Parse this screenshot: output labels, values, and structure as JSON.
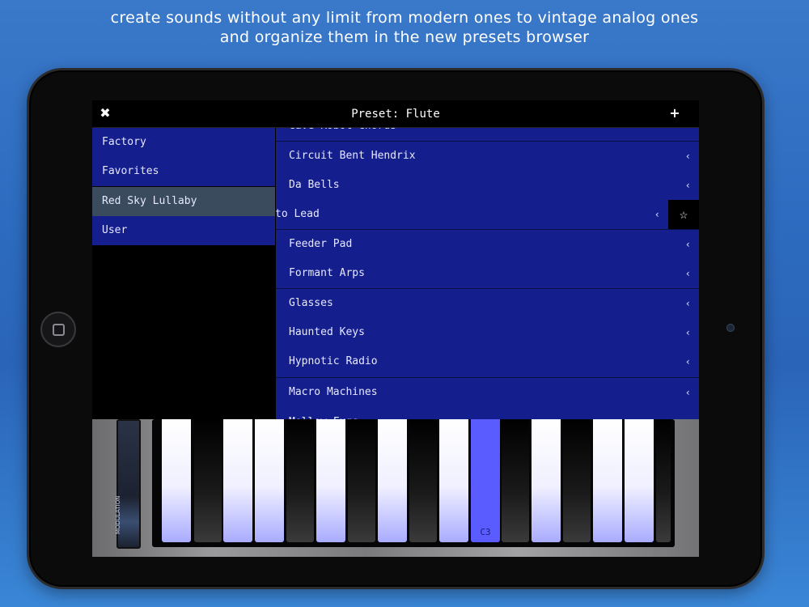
{
  "headline": {
    "line1": "create sounds without any limit from modern ones to vintage analog ones",
    "line2": "and organize them in the new presets browser"
  },
  "browser": {
    "title": "Preset: Flute",
    "close_icon": "✖",
    "add_icon": "+"
  },
  "categories": [
    {
      "label": "Factory",
      "selected": false
    },
    {
      "label": "Favorites",
      "selected": false
    },
    {
      "label": "Red Sky Lullaby",
      "selected": true
    },
    {
      "label": "User",
      "selected": false
    }
  ],
  "presets": {
    "top_partial": "Cave Robot Chords",
    "items": [
      {
        "name": "Circuit Bent Hendrix",
        "chevron": "‹"
      },
      {
        "name": "Da Bells",
        "chevron": "‹"
      },
      {
        "name": "to Lead",
        "chevron": "‹",
        "swiped": true,
        "action_icon": "☆"
      },
      {
        "name": "Feeder Pad",
        "chevron": "‹"
      },
      {
        "name": "Formant Arps",
        "chevron": "‹"
      },
      {
        "name": "Glasses",
        "chevron": "‹"
      },
      {
        "name": "Haunted Keys",
        "chevron": "‹"
      },
      {
        "name": "Hypnotic Radio",
        "chevron": "‹"
      },
      {
        "name": "Macro Machines",
        "chevron": "‹"
      }
    ],
    "bottom_partial": "Mellow Fugs",
    "bottom_partial_chevron": "‹"
  },
  "synth": {
    "modulation_label": "MODULATION",
    "active_key_label": "C3"
  },
  "colors": {
    "list_bg": "#141e8c",
    "selected_category": "#3b4b5e",
    "active_key": "#5a5cff"
  }
}
